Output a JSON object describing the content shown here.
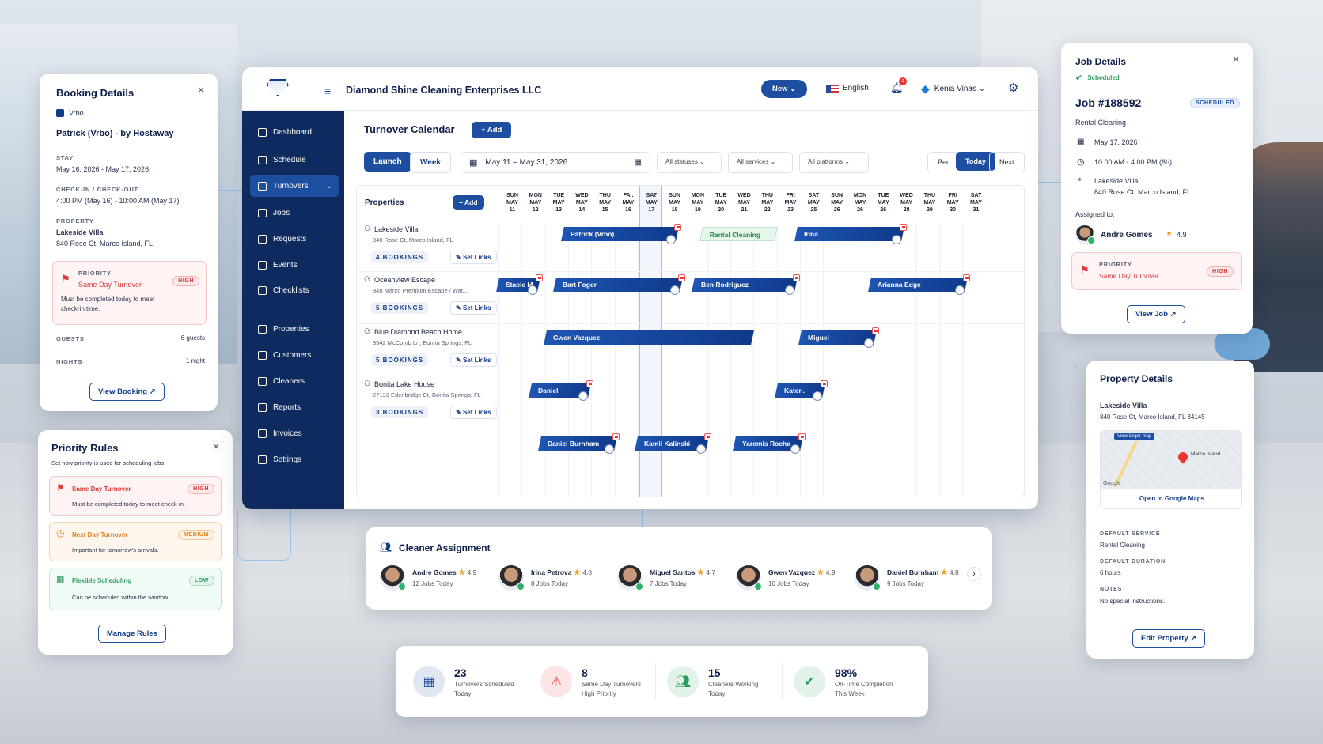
{
  "app": {
    "company": "Diamond Shine Cleaning Enterprises LLC",
    "new_btn": "New ⌄",
    "language": "English",
    "user": "Kenia Vinas ⌄",
    "notif_count": "1"
  },
  "sidebar": {
    "items": [
      "Dashboard",
      "Schedule",
      "Turnovers",
      "Jobs",
      "Requests",
      "Events",
      "Checklists",
      "Properties",
      "Customers",
      "Cleaners",
      "Reports",
      "Invoices",
      "Settings"
    ],
    "active": "Turnovers"
  },
  "calendar": {
    "title": "Turnover Calendar",
    "add": "+ Add",
    "view_launch": "Launch",
    "view_week": "Week",
    "date_range": "May 11 – May 31, 2026",
    "filters": [
      "All statuses",
      "All services",
      "All platforms"
    ],
    "nav": [
      "Per",
      "Today",
      "Next"
    ],
    "properties_label": "Properties",
    "prop_add": "+ Add",
    "days": [
      [
        "SUN",
        "MAY",
        "11"
      ],
      [
        "MON",
        "MAY",
        "12"
      ],
      [
        "TUE",
        "MAY",
        "13"
      ],
      [
        "WED",
        "MAY",
        "14"
      ],
      [
        "THU",
        "MAY",
        "15"
      ],
      [
        "FAI.",
        "MAY",
        "16"
      ],
      [
        "SAT",
        "MAY",
        "17"
      ],
      [
        "SUN",
        "MAY",
        "18"
      ],
      [
        "MON",
        "MAY",
        "19"
      ],
      [
        "TUE",
        "MAY",
        "20"
      ],
      [
        "WED",
        "MAY",
        "21"
      ],
      [
        "THU",
        "MAY",
        "22"
      ],
      [
        "FRI",
        "MAY",
        "23"
      ],
      [
        "SAT",
        "MAY",
        "25"
      ],
      [
        "SUN",
        "MAY",
        "26"
      ],
      [
        "MON",
        "MAY",
        "26"
      ],
      [
        "TUE",
        "MAY",
        "26"
      ],
      [
        "WED",
        "MAY",
        "28"
      ],
      [
        "THU",
        "MAY",
        "29"
      ],
      [
        "FRI",
        "MAY",
        "30"
      ],
      [
        "SAT",
        "MAY",
        "31"
      ]
    ],
    "properties": [
      {
        "name": "Lakeside Villa",
        "address": "840 Rose Ct, Marco Island, FL",
        "bookings": "4 BOOKINGS",
        "links": "Set Links"
      },
      {
        "name": "Oceanview Escape",
        "address": "848 Marco Premium Escape / Wat...",
        "bookings": "5 BOOKINGS",
        "links": "Set Links"
      },
      {
        "name": "Blue Diamond Beach Home",
        "address": "3542 McComb Ln, Bonita Springs, FL",
        "bookings": "5 BOOKINGS",
        "links": "Set Links"
      },
      {
        "name": "Bonita Lake House",
        "address": "27133 Edenbridge Ct, Bonita Springs, FL",
        "bookings": "3 BOOKINGS",
        "links": "Set Links"
      }
    ],
    "bars": [
      "Patrick (Vrbo)",
      "Rental Cleaning",
      "Irina",
      "Stacie M.",
      "Bart Foger",
      "Ben Rodriguez",
      "Arianna Edge",
      "Gwen Vazquez",
      "Miguel",
      "Daniel",
      "Kater..",
      "Daniel Burnham",
      "Kamil Kalinski",
      "Yaremis Rocha"
    ]
  },
  "booking": {
    "title": "Booking Details",
    "source": "Vrbo",
    "guest": "Patrick (Vrbo) - by Hostaway",
    "stay_label": "STAY",
    "stay": "May 16, 2026 - May 17, 2026",
    "cico_label": "CHECK-IN / CHECK-OUT",
    "cico": "4:00 PM (May 16) - 10:00 AM (May 17)",
    "prop_label": "PROPERTY",
    "prop_name": "Lakeside Villa",
    "prop_addr": "840 Rose Ct, Marco Island, FL",
    "priority_label": "PRIORITY",
    "priority": "Same Day Turnover",
    "priority_badge": "HIGH",
    "priority_note": "Must be completed today to meet check-in time.",
    "guests_label": "GUESTS",
    "guests": "6 guests",
    "nights_label": "NIGHTS",
    "nights": "1 night",
    "view_btn": "View Booking ↗"
  },
  "rules": {
    "title": "Priority Rules",
    "subtitle": "Set how priority is used for scheduling jobs.",
    "items": [
      {
        "name": "Same Day Turnover",
        "badge": "HIGH",
        "note": "Must be completed today to meet check-in."
      },
      {
        "name": "Next Day Turnover",
        "badge": "MEDIUM",
        "note": "Important for tomorrow's arrivals."
      },
      {
        "name": "Flexible Scheduling",
        "badge": "LOW",
        "note": "Can be scheduled within the window."
      }
    ],
    "btn": "Manage Rules"
  },
  "job": {
    "title": "Job Details",
    "status": "Scheduled",
    "job_no": "Job #188592",
    "badge": "SCHEDULED",
    "service": "Rental Cleaning",
    "date": "May 17, 2026",
    "time": "10:00 AM - 4:00 PM (6h)",
    "prop": "Lakeside Villa",
    "addr": "840 Rose Ct, Marco Island, FL",
    "assigned_label": "Assigned to:",
    "cleaner": "Andre Gomes",
    "rating": "4.9",
    "priority_label": "PRIORITY",
    "priority": "Same Day Turnover",
    "priority_badge": "HIGH",
    "btn": "View Job ↗"
  },
  "property": {
    "title": "Property Details",
    "name": "Lakeside Villa",
    "addr": "840 Rose Ct, Marco Island, FL 34145",
    "map_link": "View larger map",
    "map_place": "Marco Island",
    "map_logo": "Google",
    "maps_btn": "Open in Google Maps",
    "svc_label": "DEFAULT SERVICE",
    "svc": "Rental Cleaning",
    "dur_label": "DEFAULT DURATION",
    "dur": "6 hours",
    "notes_label": "NOTES",
    "notes": "No special instructions.",
    "btn": "Edit Property ↗"
  },
  "assign": {
    "title": "Cleaner Assignment",
    "cleaners": [
      {
        "name": "Andre Gomes",
        "rating": "4.9",
        "jobs": "12 Jobs Today"
      },
      {
        "name": "Irina Petrova",
        "rating": "4.8",
        "jobs": "8 Jobs Today"
      },
      {
        "name": "Miguel Santos",
        "rating": "4.7",
        "jobs": "7 Jobs Today"
      },
      {
        "name": "Gwen Vazquez",
        "rating": "4.9",
        "jobs": "10 Jobs Today"
      },
      {
        "name": "Daniel Burnham",
        "rating": "4.8",
        "jobs": "9 Jobs Today"
      }
    ]
  },
  "stats": [
    {
      "value": "23",
      "l1": "Turnovers Scheduled",
      "l2": "Today",
      "color": "#1d4ea0"
    },
    {
      "value": "8",
      "l1": "Same Day Turnovers",
      "l2": "High Priority",
      "color": "#e03a3a"
    },
    {
      "value": "15",
      "l1": "Cleaners Working",
      "l2": "Today",
      "color": "#2a9a5a"
    },
    {
      "value": "98%",
      "l1": "On-Time Completion",
      "l2": "This Week",
      "color": "#2a9a5a"
    }
  ]
}
